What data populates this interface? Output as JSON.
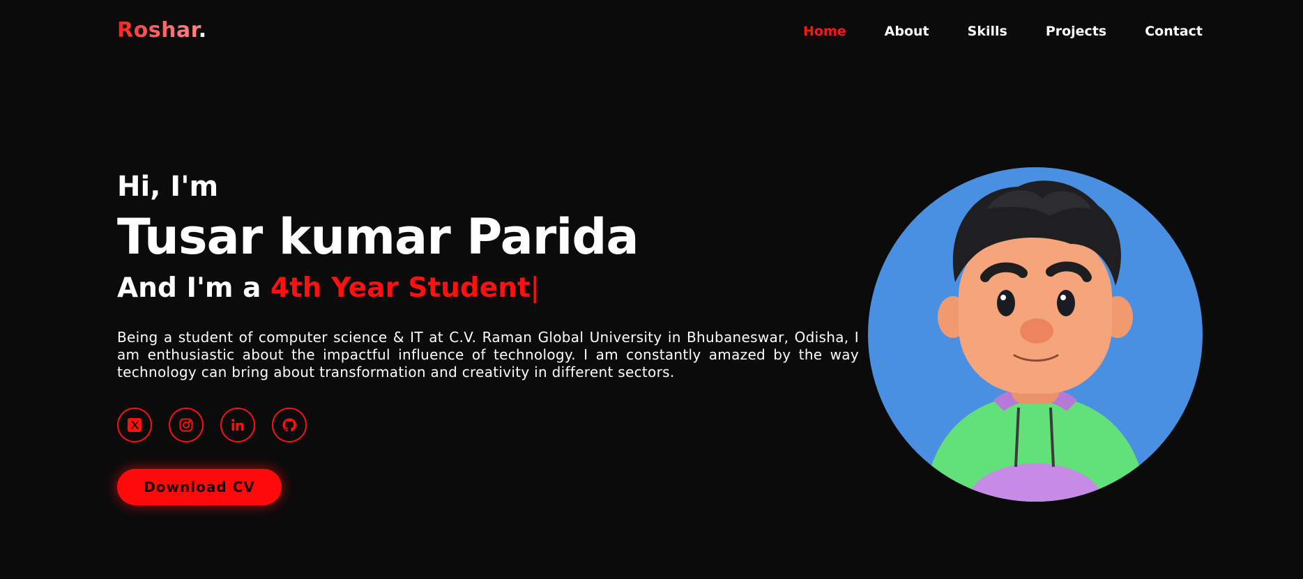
{
  "header": {
    "logo_text": "Roshar",
    "logo_dot": ".",
    "nav": [
      {
        "label": "Home",
        "active": true
      },
      {
        "label": "About"
      },
      {
        "label": "Skills"
      },
      {
        "label": "Projects"
      },
      {
        "label": "Contact"
      }
    ]
  },
  "hero": {
    "greeting": "Hi, I'm",
    "name": "Tusar kumar Parida",
    "role_prefix": "And I'm a ",
    "role_highlight": "4th Year Student",
    "role_cursor": "|",
    "bio": "Being a student of computer science & IT at C.V. Raman Global University in Bhubaneswar, Odisha, I am enthusiastic about the impactful influence of technology. I am constantly amazed by the way technology can bring about transformation and creativity in different sectors.",
    "socials": [
      {
        "icon": "x-twitter-icon"
      },
      {
        "icon": "instagram-icon"
      },
      {
        "icon": "linkedin-icon"
      },
      {
        "icon": "github-icon"
      }
    ],
    "cv_button": "Download CV"
  },
  "colors": {
    "background": "#0b0b0c",
    "accent": "#ff1010",
    "avatar_bg": "#4a90e2"
  }
}
